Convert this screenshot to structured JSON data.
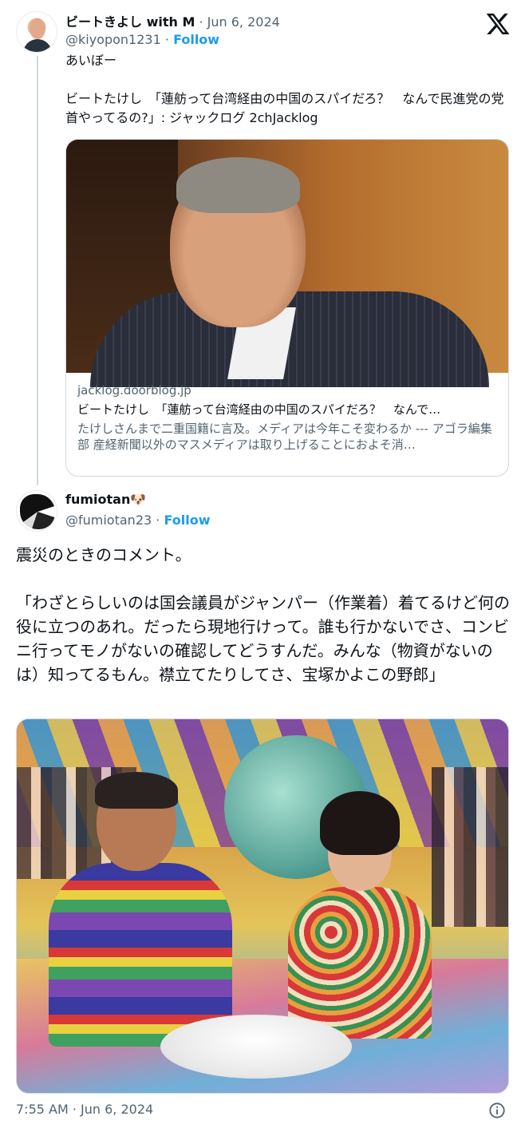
{
  "tweet1": {
    "author_name": "ビートきよし with M",
    "date": "Jun 6, 2024",
    "handle": "@kiyopon1231",
    "follow_label": "Follow",
    "text": "あいぼー\n\nビートたけし　「蓮舫って台湾経由の中国のスパイだろ？　なんで民進党の党首やってるの?」: ジャックログ 2chJacklog",
    "card": {
      "domain": "jacklog.doorblog.jp",
      "title": "ビートたけし　「蓮舫って台湾経由の中国のスパイだろ？　なんで…",
      "description": "たけしさんまで二重国籍に言及。メディアは今年こそ変わるか --- アゴラ編集部 産経新聞以外のマスメディアは取り上げることにおよそ消…"
    }
  },
  "tweet2": {
    "author_name": "fumiotan🐶",
    "handle": "@fumiotan23",
    "follow_label": "Follow",
    "text": "震災のときのコメント。\n\n「わざとらしいのは国会議員がジャンパー（作業着）着てるけど何の役に立つのあれ。だったら現地行けって。誰も行かないでさ、コンビニ行ってモノがないの確認してどうすんだ。みんな（物資がないのは）知ってるもん。襟立てたりしてさ、宝塚かよこの野郎」",
    "timestamp": "7:55 AM · Jun 6, 2024"
  },
  "separator": "·",
  "colors": {
    "follow_blue": "#1d9bf0",
    "muted": "#536471",
    "text": "#0f1419",
    "thread_line": "#cfd9de"
  },
  "icons": {
    "brand": "x-logo-icon",
    "info": "info-icon"
  }
}
